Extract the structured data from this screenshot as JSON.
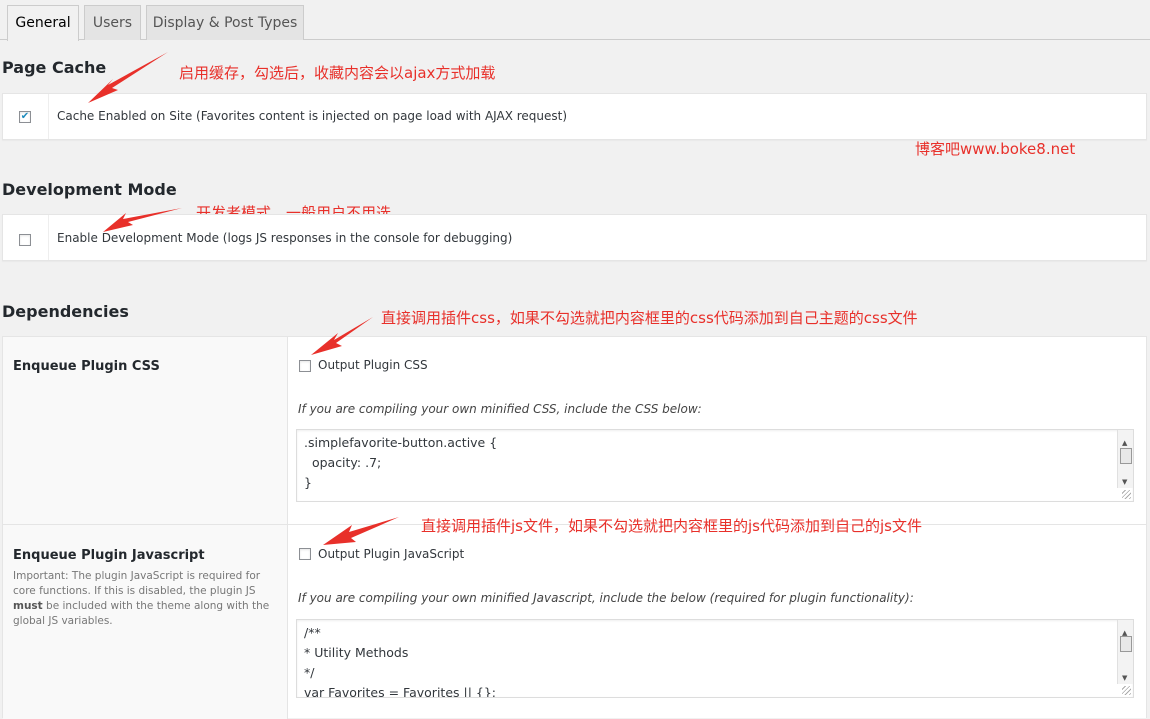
{
  "tabs": [
    {
      "label": "General",
      "active": true
    },
    {
      "label": "Users",
      "active": false
    },
    {
      "label": "Display & Post Types",
      "active": false
    }
  ],
  "page_cache": {
    "heading": "Page Cache",
    "option_label": "Cache Enabled on Site (Favorites content is injected on page load with AJAX request)",
    "checked": true,
    "note": "启用缓存，勾选后，收藏内容会以ajax方式加载"
  },
  "watermark": "博客吧www.boke8.net",
  "dev_mode": {
    "heading": "Development Mode",
    "option_label": "Enable Development Mode (logs JS responses in the console for debugging)",
    "checked": false,
    "note": "开发者模式，一般用户不用选"
  },
  "dependencies": {
    "heading": "Dependencies",
    "css": {
      "title": "Enqueue Plugin CSS",
      "option_label": "Output Plugin CSS",
      "checked": false,
      "help": "If you are compiling your own minified CSS, include the CSS below:",
      "code_lines": [
        ".simplefavorite-button.active {",
        "  opacity: .7;",
        "}"
      ],
      "note": "直接调用插件css，如果不勾选就把内容框里的css代码添加到自己主题的css文件"
    },
    "js": {
      "title": "Enqueue Plugin Javascript",
      "desc_1": "Important: The plugin JavaScript is required for core functions. If this is disabled, the plugin JS",
      "desc_bold": "must",
      "desc_2": "be included with the theme along with the global JS variables.",
      "option_label": "Output Plugin JavaScript",
      "checked": false,
      "help": "If you are compiling your own minified Javascript, include the below (required for plugin functionality):",
      "code_lines": [
        "/**",
        "* Utility Methods",
        "*/",
        "var Favorites = Favorites || {};"
      ],
      "note": "直接调用插件js文件，如果不勾选就把内容框里的js代码添加到自己的js文件"
    }
  },
  "colors": {
    "annotation": "#e8302a",
    "checkmark": "#1e8cbe"
  },
  "icons": {
    "checkmark": "✔",
    "scroll_up": "▲",
    "scroll_down": "▼"
  }
}
